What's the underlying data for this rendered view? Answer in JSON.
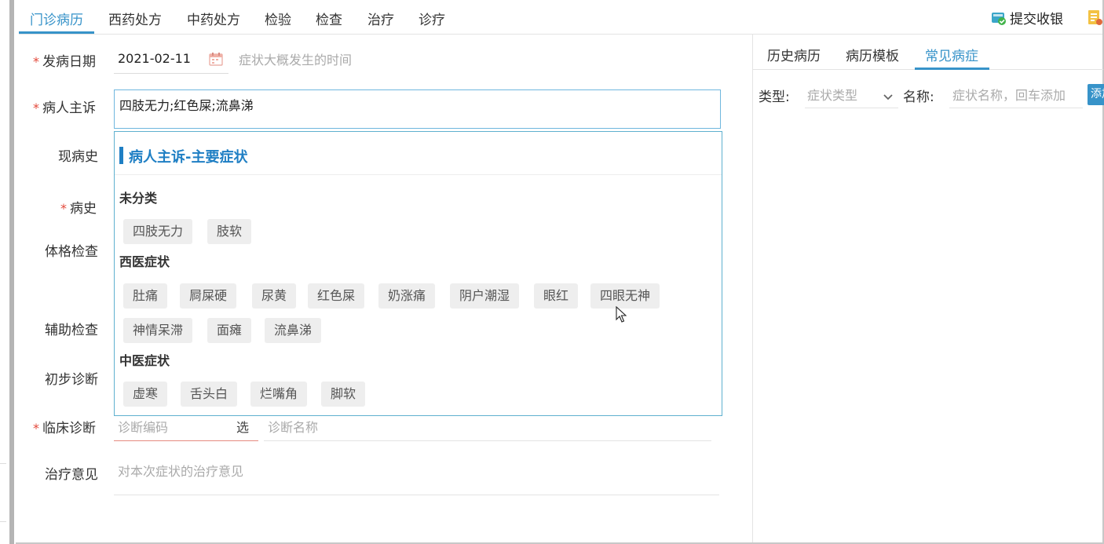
{
  "top_tabs": [
    "门诊病历",
    "西药处方",
    "中药处方",
    "检验",
    "检查",
    "治疗",
    "诊疗"
  ],
  "top_actions": {
    "submit_label": "提交收银"
  },
  "form": {
    "onset_date_label": "发病日期",
    "onset_date_value": "2021-02-11",
    "onset_hint": "症状大概发生的时间",
    "complaint_label": "病人主诉",
    "complaint_value": "四肢无力;红色屎;流鼻涕",
    "present_history_label": "现病史",
    "history_label": "病史",
    "physical_exam_label": "体格检查",
    "aux_exam_label": "辅助检查",
    "prelim_diag_label": "初步诊断",
    "clinical_diag_label": "临床诊断",
    "diag_code_placeholder": "诊断编码",
    "diag_select_label": "选",
    "diag_name_placeholder": "诊断名称",
    "treatment_label": "治疗意见",
    "treatment_placeholder": "对本次症状的治疗意见"
  },
  "symptom_panel": {
    "title": "病人主诉-主要症状",
    "categories": [
      {
        "name": "未分类",
        "items": [
          "四肢无力",
          "肢软"
        ]
      },
      {
        "name": "西医症状",
        "items": [
          "肚痛",
          "屙屎硬",
          "尿黄",
          "红色屎",
          "奶涨痛",
          "阴户潮湿",
          "眼红",
          "四眼无神",
          "神情呆滞",
          "面瘫",
          "流鼻涕"
        ]
      },
      {
        "name": "中医症状",
        "items": [
          "虚寒",
          "舌头白",
          "烂嘴角",
          "脚软"
        ]
      }
    ]
  },
  "side_panel": {
    "tabs": [
      "历史病历",
      "病历模板",
      "常见病症"
    ],
    "active_tab": "常见病症",
    "type_label": "类型:",
    "type_placeholder": "症状类型",
    "name_label": "名称:",
    "name_placeholder": "症状名称，回车添加",
    "add_button": "添加"
  },
  "colors": {
    "accent": "#3793c9",
    "panel_title": "#1f7fc4",
    "required": "#e4483a",
    "chip_bg": "#eeeeee"
  }
}
